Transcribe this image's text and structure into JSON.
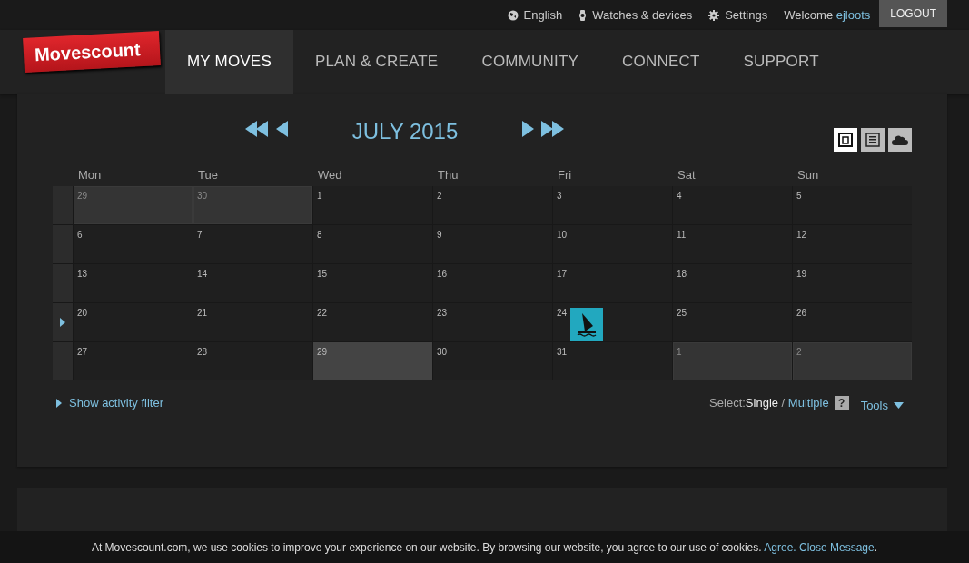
{
  "topbar": {
    "links": [
      {
        "label": "English",
        "kind": "language"
      },
      {
        "label": "Watches & devices",
        "kind": "devices"
      },
      {
        "label": "Settings",
        "kind": "settings"
      }
    ],
    "welcome": "Welcome",
    "user": "ejloots",
    "logout": "LOGOUT"
  },
  "nav": {
    "logo": "Movescount",
    "items": [
      {
        "label": "MY MOVES",
        "selected": true
      },
      {
        "label": "PLAN & CREATE",
        "selected": false
      },
      {
        "label": "COMMUNITY",
        "selected": false
      },
      {
        "label": "CONNECT",
        "selected": false
      },
      {
        "label": "SUPPORT",
        "selected": false
      }
    ]
  },
  "calendar": {
    "title": "JULY 2015",
    "views": [
      {
        "kind": "month",
        "selected": true
      },
      {
        "kind": "list",
        "selected": false
      },
      {
        "kind": "cloud",
        "selected": false
      }
    ],
    "weekdays": [
      "Mon",
      "Tue",
      "Wed",
      "Thu",
      "Fri",
      "Sat",
      "Sun"
    ],
    "weeks": [
      {
        "selected": false,
        "days": [
          {
            "label": "29",
            "other_month": true,
            "today": false
          },
          {
            "label": "30",
            "other_month": true,
            "today": false
          },
          {
            "label": "1",
            "other_month": false,
            "today": false
          },
          {
            "label": "2",
            "other_month": false,
            "today": false
          },
          {
            "label": "3",
            "other_month": false,
            "today": false
          },
          {
            "label": "4",
            "other_month": false,
            "today": false
          },
          {
            "label": "5",
            "other_month": false,
            "today": false
          }
        ]
      },
      {
        "selected": false,
        "days": [
          {
            "label": "6",
            "other_month": false,
            "today": false
          },
          {
            "label": "7",
            "other_month": false,
            "today": false
          },
          {
            "label": "8",
            "other_month": false,
            "today": false
          },
          {
            "label": "9",
            "other_month": false,
            "today": false
          },
          {
            "label": "10",
            "other_month": false,
            "today": false
          },
          {
            "label": "11",
            "other_month": false,
            "today": false
          },
          {
            "label": "12",
            "other_month": false,
            "today": false
          }
        ]
      },
      {
        "selected": false,
        "days": [
          {
            "label": "13",
            "other_month": false,
            "today": false
          },
          {
            "label": "14",
            "other_month": false,
            "today": false
          },
          {
            "label": "15",
            "other_month": false,
            "today": false
          },
          {
            "label": "16",
            "other_month": false,
            "today": false
          },
          {
            "label": "17",
            "other_month": false,
            "today": false
          },
          {
            "label": "18",
            "other_month": false,
            "today": false
          },
          {
            "label": "19",
            "other_month": false,
            "today": false
          }
        ]
      },
      {
        "selected": true,
        "days": [
          {
            "label": "20",
            "other_month": false,
            "today": false
          },
          {
            "label": "21",
            "other_month": false,
            "today": false
          },
          {
            "label": "22",
            "other_month": false,
            "today": false
          },
          {
            "label": "23",
            "other_month": false,
            "today": false
          },
          {
            "label": "24",
            "other_month": false,
            "today": false,
            "moves": [
              {
                "kind": "windsurfing"
              }
            ]
          },
          {
            "label": "25",
            "other_month": false,
            "today": false
          },
          {
            "label": "26",
            "other_month": false,
            "today": false
          }
        ]
      },
      {
        "selected": false,
        "days": [
          {
            "label": "27",
            "other_month": false,
            "today": false
          },
          {
            "label": "28",
            "other_month": false,
            "today": false
          },
          {
            "label": "29",
            "other_month": false,
            "today": true
          },
          {
            "label": "30",
            "other_month": false,
            "today": false
          },
          {
            "label": "31",
            "other_month": false,
            "today": false
          },
          {
            "label": "1",
            "other_month": true,
            "today": false
          },
          {
            "label": "2",
            "other_month": true,
            "today": false
          }
        ]
      }
    ],
    "filter_link": "Show activity filter",
    "select_label": "Select:",
    "single": "Single",
    "separator": "/",
    "multiple": "Multiple",
    "help": "?",
    "tools": "Tools"
  },
  "cookie": {
    "text": "At Movescount.com, we use cookies to improve your experience on our website. By browsing our website, you agree to our use of cookies.",
    "agree": "Agree.",
    "close": "Close Message",
    "end": "."
  }
}
